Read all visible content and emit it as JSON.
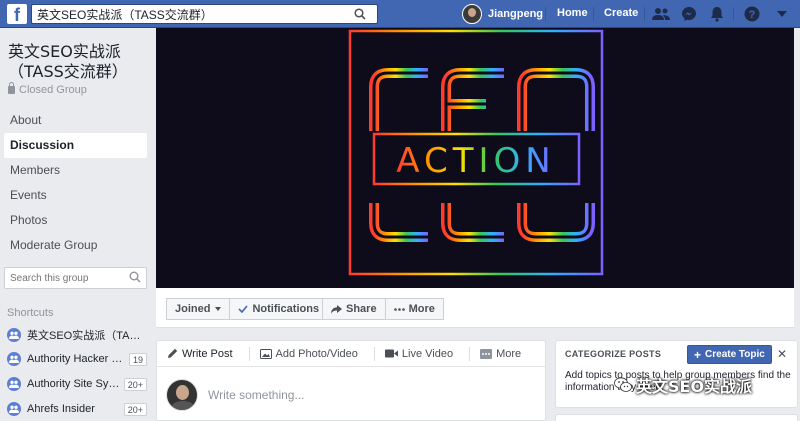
{
  "topbar": {
    "logo": "f",
    "search_value": "英文SEO实战派（TASS交流群）",
    "user_name": "Jiangpeng",
    "home_label": "Home",
    "create_label": "Create",
    "icons": [
      "friends-icon",
      "messenger-icon",
      "bell-icon",
      "help-icon",
      "caret-down-icon"
    ],
    "brand_color": "#4267b2"
  },
  "group": {
    "name": "英文SEO实战派（TASS交流群）",
    "privacy": "Closed Group"
  },
  "nav": {
    "items": [
      {
        "label": "About"
      },
      {
        "label": "Discussion",
        "active": true
      },
      {
        "label": "Members"
      },
      {
        "label": "Events"
      },
      {
        "label": "Photos"
      },
      {
        "label": "Moderate Group"
      }
    ]
  },
  "group_search": {
    "placeholder": "Search this group"
  },
  "shortcuts": {
    "title": "Shortcuts",
    "items": [
      {
        "label": "英文SEO实战派（TASS...",
        "count": ""
      },
      {
        "label": "Authority Hacker Pro",
        "count": "19"
      },
      {
        "label": "Authority Site Syst...",
        "count": "20+"
      },
      {
        "label": "Ahrefs Insider",
        "count": "20+"
      }
    ]
  },
  "cover": {
    "logo_text_top": "SEO",
    "logo_text_middle": "ACTION",
    "background": "#0e0c1a"
  },
  "actions": {
    "joined": "Joined",
    "notifications": "Notifications",
    "share": "Share",
    "more": "More"
  },
  "composer": {
    "tabs": [
      {
        "label": "Write Post",
        "icon": "pencil-icon"
      },
      {
        "label": "Add Photo/Video",
        "icon": "photo-icon"
      },
      {
        "label": "Live Video",
        "icon": "video-icon"
      },
      {
        "label": "More",
        "icon": "more-icon"
      }
    ],
    "placeholder": "Write something..."
  },
  "categorize": {
    "title": "CATEGORIZE POSTS",
    "create_label": "Create Topic",
    "description": "Add topics to posts to help group members find the information they need."
  },
  "watermark": "英文SEO实战派"
}
